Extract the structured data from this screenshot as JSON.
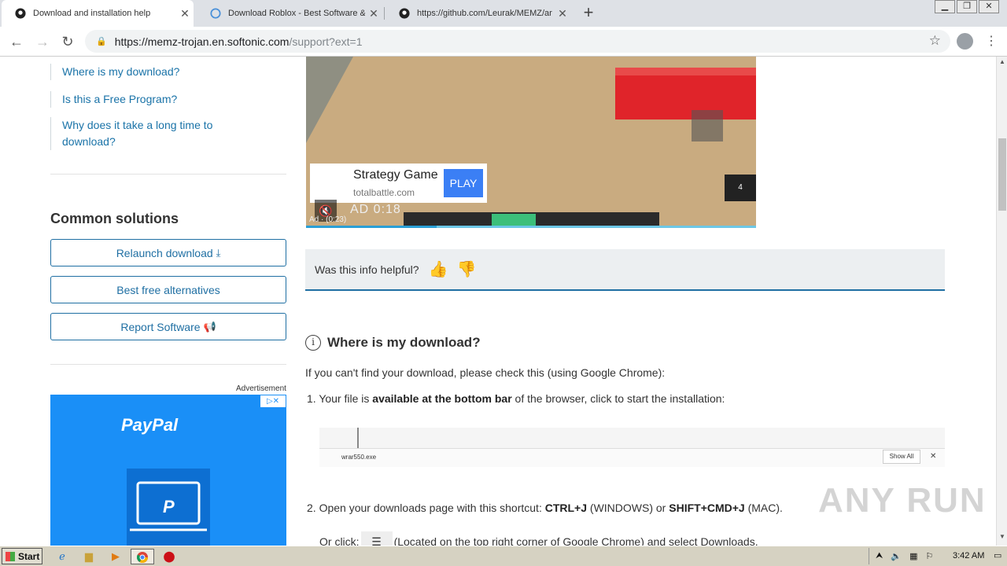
{
  "browser": {
    "tabs": [
      {
        "title": "Download and installation help",
        "close": "✕",
        "icon": "github-icon"
      },
      {
        "title": "Download Roblox - Best Software &",
        "close": "✕",
        "icon": "softonic-icon"
      },
      {
        "title": "https://github.com/Leurak/MEMZ/ar",
        "close": "✕",
        "icon": "github-icon"
      }
    ],
    "new_tab": "+",
    "url_host": "https://memz-trojan.en.softonic.com",
    "url_path": "/support?ext=1"
  },
  "sidebar": {
    "faq_links": [
      "Where is my download?",
      "Is this a Free Program?",
      "Why does it take a long time to download?"
    ],
    "common_title": "Common solutions",
    "buttons": [
      {
        "label": "Relaunch download",
        "icon": "download-icon"
      },
      {
        "label": "Best free alternatives"
      },
      {
        "label": "Report Software",
        "icon": "megaphone-icon"
      }
    ],
    "ad_label": "Advertisement",
    "paypal_logo": "PayPal",
    "ad_choice": "▷✕"
  },
  "video_ad": {
    "title": "Strategy Game",
    "source": "totalbattle.com",
    "play": "PLAY",
    "counter": "4",
    "ad_time": "AD  0:18",
    "ad_sub": "Ad · (0:23)",
    "progress": 0.29
  },
  "helpful": {
    "question": "Was this info helpful?"
  },
  "article": {
    "title": "Where is my download?",
    "intro": "If you can't find your download, please check this (using Google Chrome):",
    "step1_pre": "1. Your file is ",
    "step1_bold": "available at the bottom bar",
    "step1_post": " of the browser, click to start the installation:",
    "dl_file": "wrar550.exe",
    "dl_show_all": "Show All",
    "step2_pre": "2. Open your downloads page with this shortcut: ",
    "step2_k1": "CTRL+J",
    "step2_mid": " (WINDOWS) or ",
    "step2_k2": "SHIFT+CMD+J",
    "step2_post": " (MAC).",
    "orclick_pre": "Or click:",
    "orclick_post": "(Located on the top right corner of Google Chrome) and select Downloads."
  },
  "watermark": "ANY RUN",
  "taskbar": {
    "start": "Start",
    "clock": "3:42 AM"
  }
}
